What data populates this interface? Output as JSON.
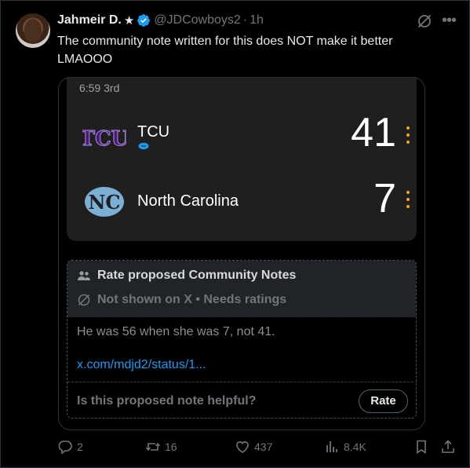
{
  "tweet": {
    "author_name": "Jahmeir D.",
    "author_star": "★",
    "handle": "@JDCowboys2",
    "separator": "·",
    "time": "1h",
    "text": "The community note written for this does NOT make it better LMAOOO"
  },
  "scoreboard": {
    "game_clock": "6:59 3rd",
    "teams": [
      {
        "name": "TCU",
        "score": "41",
        "logo": "tcu-logo",
        "has_possession": true
      },
      {
        "name": "North Carolina",
        "score": "7",
        "logo": "unc-logo",
        "has_possession": false
      }
    ],
    "accent_color": "#f5a623"
  },
  "community_note": {
    "title": "Rate proposed Community Notes",
    "status": "Not shown on X • Needs ratings",
    "body": "He was 56 when she was 7, not 41.",
    "link": "x.com/mdjd2/status/1...",
    "question": "Is this proposed note helpful?",
    "rate_label": "Rate"
  },
  "actions": {
    "replies": "2",
    "reposts": "16",
    "likes": "437",
    "views": "8.4K"
  },
  "colors": {
    "background": "#000000",
    "link": "#1d9bf0",
    "muted": "#71767b",
    "verified": "#1d9bf0"
  }
}
